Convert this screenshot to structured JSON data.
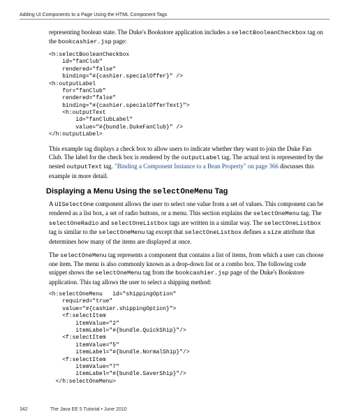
{
  "header": "Adding UI Components to a Page Using the HTML Component Tags",
  "intro_p1a": "representing boolean state. The Duke's Bookstore application includes a ",
  "intro_p1b": "selectBooleanCheckbox",
  "intro_p1c": " tag on the ",
  "intro_p1d": "bookcashier.jsp",
  "intro_p1e": " page:",
  "code1": "<h:selectBooleanCheckbox\n    id=\"fanClub\"\n    rendered=\"false\"\n    binding=\"#{cashier.specialOffer}\" />\n<h:outputLabel\n    for=\"fanClub\"\n    rendered=\"false\"\n    binding=\"#{cashier.specialOfferText}\">\n    <h:outputText\n        id=\"fanClubLabel\"\n        value=\"#{bundle.DukeFanClub}\" />\n</h:outputLabel>",
  "para2a": "This example tag displays a check box to allow users to indicate whether they want to join the Duke Fan Club. The label for the check box is rendered by the ",
  "para2b": "outputLabel",
  "para2c": " tag. The actual text is represented by the nested ",
  "para2d": "outputText",
  "para2e": " tag. ",
  "link1": "\"Binding a Component Instance to a Bean Property\" on page 366",
  "para2f": " discusses this example in more detail.",
  "h2a": "Displaying a Menu Using the ",
  "h2b": "selectOneMenu",
  "h2c": " Tag",
  "para3a": "A ",
  "para3b": "UISelectOne",
  "para3c": " component allows the user to select one value from a set of values. This component can be rendered as a list box, a set of radio buttons, or a menu. This section explains the ",
  "para3d": "selectOneMenu",
  "para3e": " tag. The ",
  "para3f": "selectOneRadio",
  "para3g": " and ",
  "para3h": "selectOneListbox",
  "para3i": " tags are written in a similar way. The ",
  "para3j": "selectOneListbox",
  "para3k": " tag is similar to the ",
  "para3l": "selectOneMenu",
  "para3m": " tag except that ",
  "para3n": "selectOneListbox",
  "para3o": " defines a ",
  "para3p": "size",
  "para3q": " attribute that determines how many of the items are displayed at once.",
  "para4a": "The ",
  "para4b": "selectOneMenu",
  "para4c": " tag represents a component that contains a list of items, from which a user can choose one item. The menu is also commonly known as a drop-down list or a combo box. The following code snippet shows the ",
  "para4d": "selectOneMenu",
  "para4e": " tag from the ",
  "para4f": "bookcashier.jsp",
  "para4g": " page of the Duke's Bookstore application. This tag allows the user to select a shipping method:",
  "code2": "<h:selectOneMenu   id=\"shippingOption\"\n    required=\"true\"\n    value=\"#{cashier.shippingOption}\">\n    <f:selectItem\n        itemValue=\"2\"\n        itemLabel=\"#{bundle.QuickShip}\"/>\n    <f:selectItem\n        itemValue=\"5\"\n        itemLabel=\"#{bundle.NormalShip}\"/>\n    <f:selectItem\n        itemValue=\"7\"\n        itemLabel=\"#{bundle.SaverShip}\"/>\n  </h:selectOneMenu>",
  "footer_page": "342",
  "footer_text": "The Java EE 5 Tutorial   •   June 2010"
}
